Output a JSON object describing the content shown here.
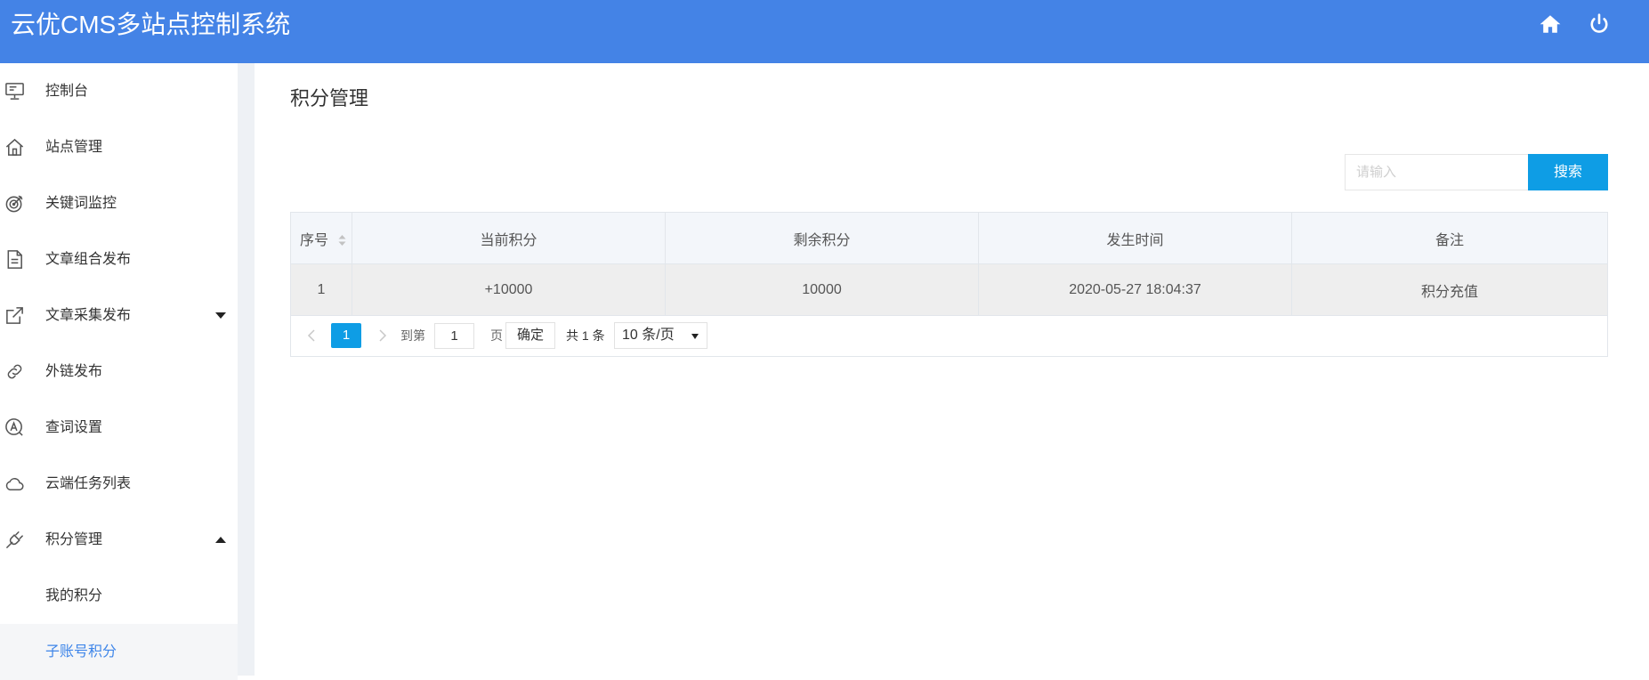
{
  "app": {
    "title": "云优CMS多站点控制系统"
  },
  "header": {
    "icons": [
      "home-icon",
      "power-icon"
    ]
  },
  "sidebar": {
    "items": [
      {
        "label": "控制台",
        "icon": "monitor-icon"
      },
      {
        "label": "站点管理",
        "icon": "home-icon"
      },
      {
        "label": "关键词监控",
        "icon": "target-icon"
      },
      {
        "label": "文章组合发布",
        "icon": "document-icon"
      },
      {
        "label": "文章采集发布",
        "icon": "external-link-icon",
        "caret": "down"
      },
      {
        "label": "外链发布",
        "icon": "link-icon"
      },
      {
        "label": "查词设置",
        "icon": "search-a-icon"
      },
      {
        "label": "云端任务列表",
        "icon": "cloud-icon"
      },
      {
        "label": "积分管理",
        "icon": "plug-icon",
        "caret": "up"
      }
    ],
    "subitems": [
      {
        "label": "我的积分",
        "active": false
      },
      {
        "label": "子账号积分",
        "active": true
      }
    ]
  },
  "main": {
    "title": "积分管理",
    "search": {
      "placeholder": "请输入",
      "button": "搜索"
    },
    "table": {
      "columns": [
        "序号",
        "当前积分",
        "剩余积分",
        "发生时间",
        "备注"
      ],
      "rows": [
        [
          "1",
          "+10000",
          "10000",
          "2020-05-27 18:04:37",
          "积分充值"
        ]
      ]
    },
    "pagination": {
      "current": "1",
      "goto_label": "到第",
      "goto_value": "1",
      "page_suffix": "页",
      "confirm": "确定",
      "total": "共 1 条",
      "page_size": "10 条/页"
    }
  },
  "colors": {
    "header": "#4483E6",
    "primary_button": "#0E9DE5",
    "active_menu_text": "#3F86E9",
    "table_header_bg": "#F3F6FA",
    "row_hover_bg": "#EEEEEE"
  }
}
